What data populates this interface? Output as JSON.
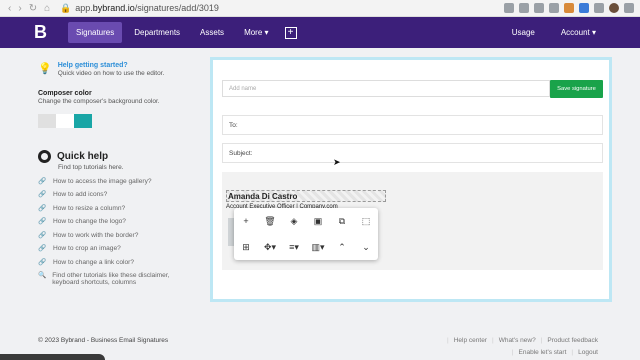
{
  "browser": {
    "url_prefix": "app.",
    "url_domain": "bybrand.io",
    "url_path": "/signatures/add/3019"
  },
  "nav": {
    "logo": "B",
    "items": [
      "Signatures",
      "Departments",
      "Assets",
      "More ▾"
    ],
    "right": [
      "Usage",
      "Account ▾"
    ]
  },
  "sidebar": {
    "help_title": "Help getting started?",
    "help_sub": "Quick video on how to use the editor.",
    "composer_title": "Composer color",
    "composer_sub": "Change the composer's background color.",
    "swatches": [
      "#e0e0e0",
      "#ffffff",
      "#19a6a6"
    ],
    "quick_help_title": "Quick help",
    "quick_help_sub": "Find top tutorials here.",
    "links": [
      "How to access the image gallery?",
      "How to add icons?",
      "How to resize a column?",
      "How to change the logo?",
      "How to work with the border?",
      "How to crop an image?",
      "How to change a link color?"
    ],
    "other": "Find other tutorials like these disclaimer, keyboard shortcuts, columns"
  },
  "editor": {
    "name_placeholder": "Add name",
    "save_label": "Save signature",
    "to_label": "To:",
    "subject_label": "Subject:",
    "sig_name": "Amanda Di Castro",
    "sig_role": "Account Executive Officer | ",
    "sig_company": "Company.com"
  },
  "toolbar_icons": [
    "plus-icon",
    "trash-icon",
    "paint-bucket-icon",
    "image-icon",
    "duplicate-icon",
    "select-icon",
    "table-icon",
    "vertical-align-icon",
    "text-align-icon",
    "column-icon",
    "arrow-up-icon",
    "arrow-down-icon"
  ],
  "footer": {
    "copyright": "© 2023 Bybrand - Business Email Signatures",
    "links_row1": [
      "Help center",
      "What's new?",
      "Product feedback"
    ],
    "links_row2": [
      "Enable let's start",
      "Logout"
    ]
  }
}
